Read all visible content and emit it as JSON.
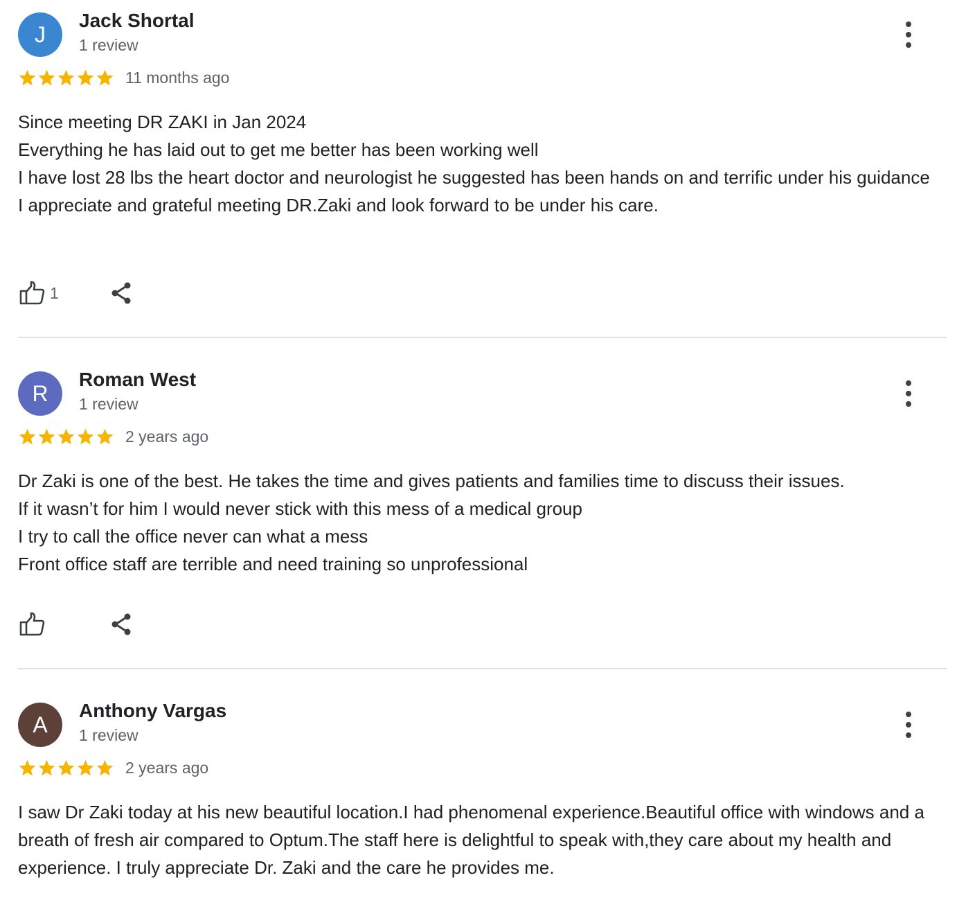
{
  "colors": {
    "star": "#f4b400",
    "avatar_j": "#3a86d1",
    "avatar_r": "#5c6bc0",
    "avatar_a": "#5d4037"
  },
  "icons": {
    "more": "more-vertical-icon",
    "like": "thumb-up-icon",
    "share": "share-icon",
    "star": "star-icon"
  },
  "reviews": [
    {
      "avatar_letter": "J",
      "name": "Jack Shortal",
      "review_count": "1 review",
      "rating": 5,
      "time": "11 months ago",
      "lines": [
        "Since meeting DR ZAKI in Jan 2024",
        "Everything he has laid out to get me better has been working well",
        "I have lost 28 lbs the heart doctor and neurologist he suggested has been hands on and terrific under his guidance",
        "I appreciate and grateful meeting DR.Zaki and look forward to be under his care."
      ],
      "likes": "1"
    },
    {
      "avatar_letter": "R",
      "name": "Roman West",
      "review_count": "1 review",
      "rating": 5,
      "time": "2 years ago",
      "lines": [
        "Dr Zaki is one of the best. He takes the time and gives patients and families time to discuss their issues.",
        "If it wasn’t for him I would never stick with this mess of a medical group",
        "I try to call the office never can what a mess",
        "Front office staff are terrible and need training so unprofessional"
      ],
      "likes": ""
    },
    {
      "avatar_letter": "A",
      "name": "Anthony Vargas",
      "review_count": "1 review",
      "rating": 5,
      "time": "2 years ago",
      "lines": [
        "I saw Dr Zaki today at his new beautiful location.I had phenomenal experience.Beautiful office with windows and a breath of fresh air compared to Optum.The staff here is delightful to speak with,they care about my health and experience. I truly appreciate Dr. Zaki and the care he provides me."
      ],
      "likes": ""
    }
  ]
}
